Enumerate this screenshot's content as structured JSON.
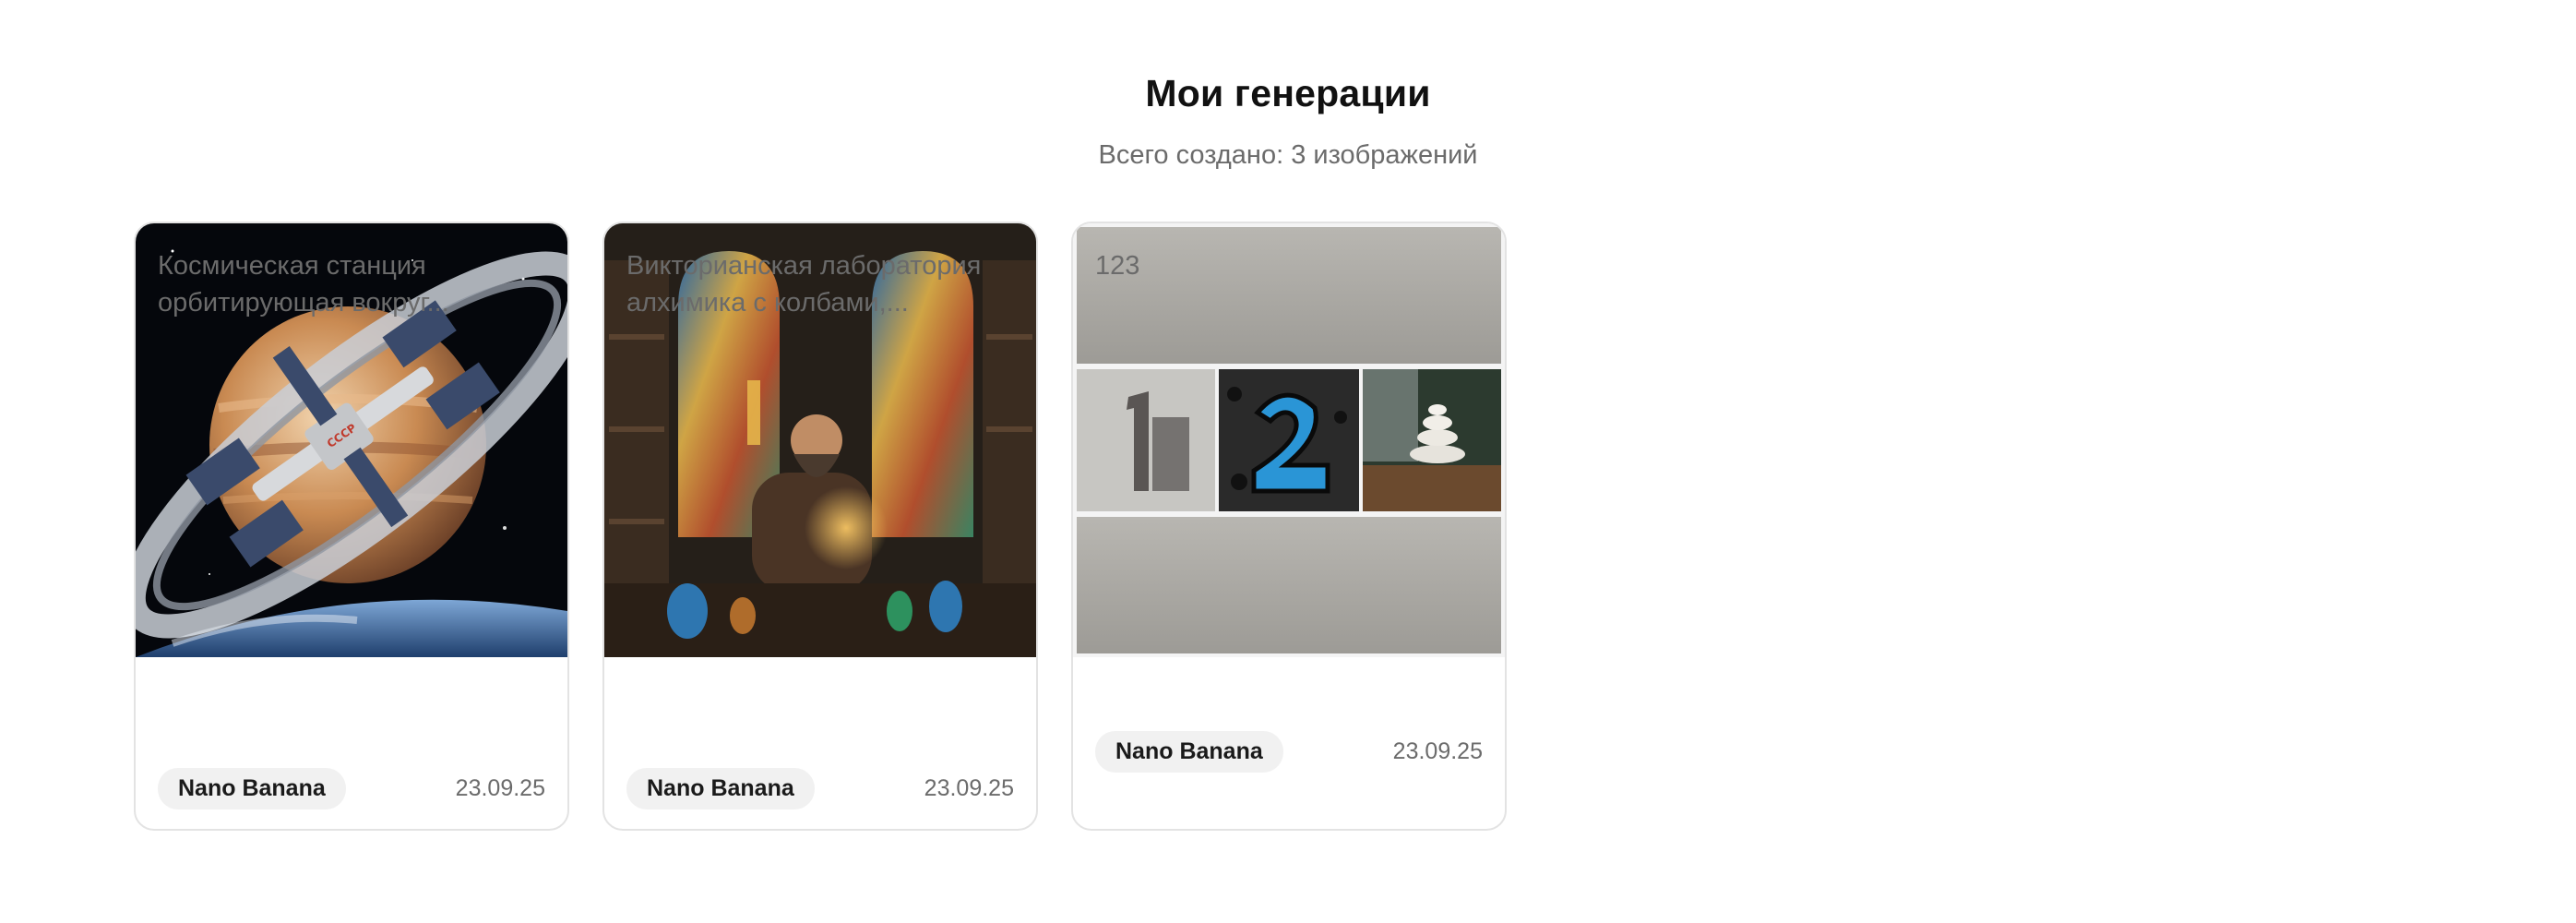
{
  "header": {
    "title": "Мои генерации",
    "subtitle": "Всего создано: 3 изображений"
  },
  "cards": [
    {
      "title_line1": "Космическая станция",
      "title_line2": "орбитирующая вокруг...",
      "model": "Nano Banana",
      "date": "23.09.25",
      "image": "space-station-orbiting-saturn"
    },
    {
      "title_line1": "Викторианская лаборатория",
      "title_line2": "алхимика с колбами,...",
      "model": "Nano Banana",
      "date": "23.09.25",
      "image": "victorian-alchemist-laboratory"
    },
    {
      "title_line1": "123",
      "title_line2": "",
      "model": "Nano Banana",
      "date": "23.09.25",
      "image": "concrete-wall-collage-1-2-stones"
    }
  ],
  "colors": {
    "title": "#111111",
    "muted": "#6b6b6b",
    "border": "#e3e3e3",
    "badge_bg": "#f1f1f1"
  }
}
